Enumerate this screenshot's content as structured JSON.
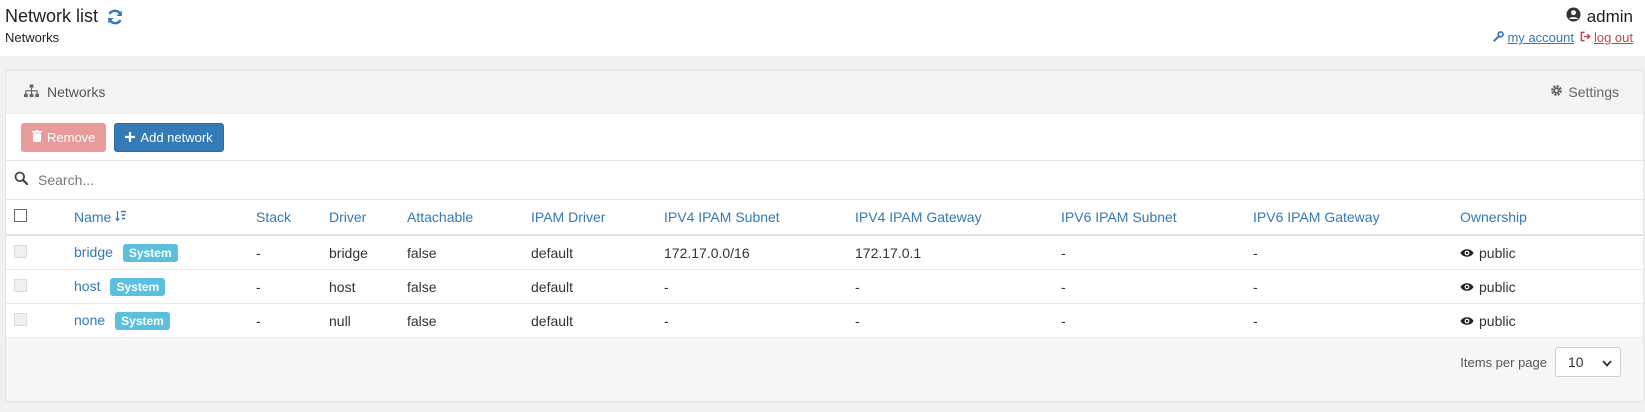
{
  "header": {
    "title": "Network list",
    "breadcrumb": "Networks",
    "user": "admin",
    "my_account": "my account",
    "log_out": "log out"
  },
  "widget": {
    "title": "Networks",
    "settings": "Settings"
  },
  "actions": {
    "remove": "Remove",
    "add": "Add network"
  },
  "search": {
    "placeholder": "Search..."
  },
  "columns": [
    "Name",
    "Stack",
    "Driver",
    "Attachable",
    "IPAM Driver",
    "IPV4 IPAM Subnet",
    "IPV4 IPAM Gateway",
    "IPV6 IPAM Subnet",
    "IPV6 IPAM Gateway",
    "Ownership"
  ],
  "rows": [
    {
      "name": "bridge",
      "badge": "System",
      "stack": "-",
      "driver": "bridge",
      "attachable": "false",
      "ipam_driver": "default",
      "ipv4_subnet": "172.17.0.0/16",
      "ipv4_gateway": "172.17.0.1",
      "ipv6_subnet": "-",
      "ipv6_gateway": "-",
      "ownership": "public"
    },
    {
      "name": "host",
      "badge": "System",
      "stack": "-",
      "driver": "host",
      "attachable": "false",
      "ipam_driver": "default",
      "ipv4_subnet": "-",
      "ipv4_gateway": "-",
      "ipv6_subnet": "-",
      "ipv6_gateway": "-",
      "ownership": "public"
    },
    {
      "name": "none",
      "badge": "System",
      "stack": "-",
      "driver": "null",
      "attachable": "false",
      "ipam_driver": "default",
      "ipv4_subnet": "-",
      "ipv4_gateway": "-",
      "ipv6_subnet": "-",
      "ipv6_gateway": "-",
      "ownership": "public"
    }
  ],
  "footer": {
    "items_per_page_label": "Items per page",
    "items_per_page": "10"
  },
  "colors": {
    "primary": "#337ab7",
    "danger_disabled": "#e89b9b",
    "badge": "#5bc0de",
    "logout": "#b94a48"
  },
  "icons": [
    "refresh-icon",
    "user-circle-icon",
    "wrench-icon",
    "sign-out-icon",
    "sitemap-icon",
    "gear-icon",
    "trash-icon",
    "plus-icon",
    "search-icon",
    "sort-icon",
    "eye-icon",
    "chevron-down-icon"
  ]
}
